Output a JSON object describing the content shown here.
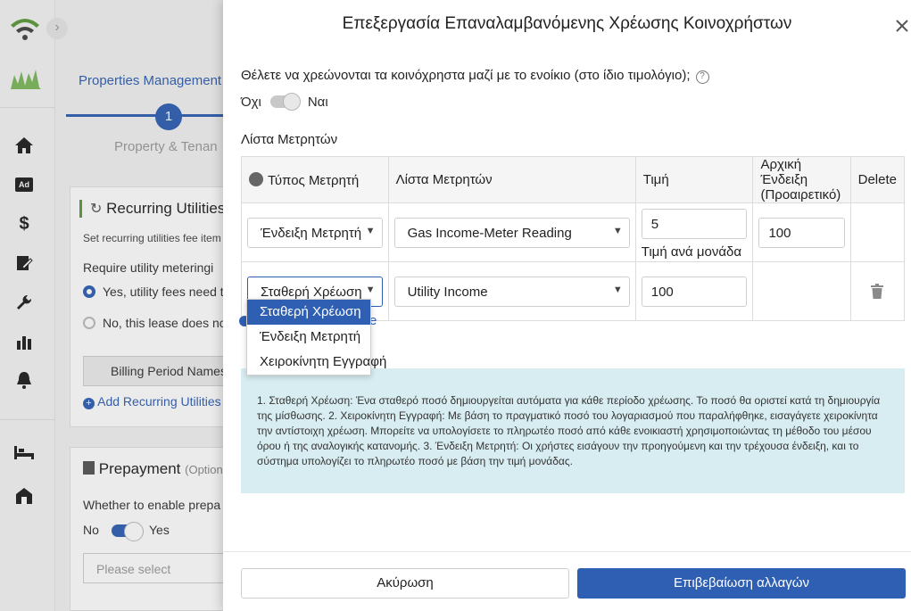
{
  "background": {
    "sidebar": {
      "icons": [
        "wifi-logo-icon",
        "brand-logo-icon",
        "home-icon",
        "ad-icon",
        "dollar-icon",
        "edit-document-icon",
        "wrench-icon",
        "bar-chart-icon",
        "bell-icon",
        "bed-icon",
        "building-icon"
      ],
      "ad_label": "Ad"
    },
    "tab_label": "Properties Management M",
    "step_number": "1",
    "step_label": "Property & Tenan",
    "recurring_card": {
      "title": "Recurring Utilities",
      "subtitle": "Set recurring utilities fee item",
      "question": "Require utility meteringi",
      "option_yes": "Yes, utility fees need t",
      "option_no": "No, this lease does nc",
      "billing_button": "Billing Period Names",
      "add_link": "Add Recurring Utilities"
    },
    "prepayment_card": {
      "title": "Prepayment",
      "title_suffix": "(Option",
      "question": "Whether to enable prepa",
      "toggle_off": "No",
      "toggle_on": "Yes",
      "select_placeholder": "Please select"
    }
  },
  "drawer": {
    "title": "Επεξεργασία Επαναλαμβανόμενης Χρέωσης Κοινοχρήστων",
    "question": "Θέλετε να χρεώνονται τα κοινόχρηστα μαζί με το ενοίκιο (στο ίδιο τιμολόγιο);",
    "toggle_off_label": "Όχι",
    "toggle_on_label": "Ναι",
    "section_title": "Λίστα Μετρητών",
    "table": {
      "headers": {
        "meter_type": "Τύπος Μετρητή",
        "meter_list": "Λίστα Μετρητών",
        "price": "Τιμή",
        "initial_reading_line1": "Αρχική Ένδειξη",
        "initial_reading_line2": "(Προαιρετικό)",
        "delete": "Delete"
      },
      "rows": [
        {
          "meter_type": "Ένδειξη Μετρητή",
          "meter": "Gas Income-Meter Reading",
          "price": "5",
          "price_unit": "Τιμή ανά μονάδα",
          "initial_reading": "100"
        },
        {
          "meter_type": "Σταθερή Χρέωση",
          "meter": "Utility Income",
          "price": "100",
          "initial_reading": ""
        }
      ]
    },
    "dropdown_options": [
      "Σταθερή Χρέωση",
      "Ένδειξη Μετρητή",
      "Χειροκίνητη Εγγραφή"
    ],
    "hidden_link_tail": "e",
    "info_text": "1. Σταθερή Χρέωση: Ένα σταθερό ποσό δημιουργείται αυτόματα για κάθε περίοδο χρέωσης. Το ποσό θα οριστεί κατά τη δημιουργία της μίσθωσης. 2. Χειροκίνητη Εγγραφή: Με βάση το πραγματικό ποσό του λογαριασμού που παραλήφθηκε, εισαγάγετε χειροκίνητα την αντίστοιχη χρέωση. Μπορείτε να υπολογίσετε το πληρωτέο ποσό από κάθε ενοικιαστή χρησιμοποιώντας τη μέθοδο του μέσου όρου ή της αναλογικής κατανομής. 3. Ένδειξη Μετρητή: Οι χρήστες εισάγουν την προηγούμενη και την τρέχουσα ένδειξη, και το σύστημα υπολογίζει το πληρωτέο ποσό με βάση την τιμή μονάδας.",
    "cancel_label": "Ακύρωση",
    "confirm_label": "Επιβεβαίωση αλλαγών",
    "accent_color": "#2f5fb3"
  }
}
